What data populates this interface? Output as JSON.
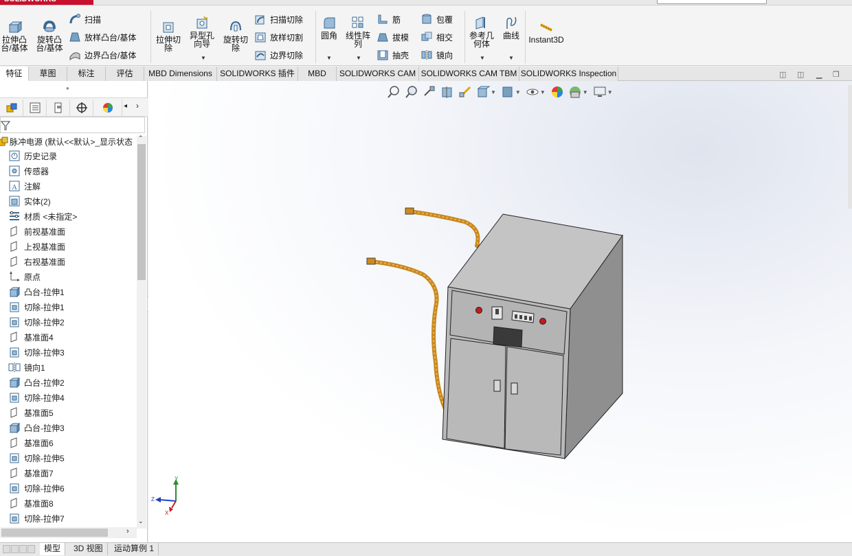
{
  "app": {
    "logo_text": "SOLIDWORKS",
    "brand_color": "#c8102e"
  },
  "ribbon": {
    "extrude_boss": "拉伸凸台/基体",
    "revolve_boss": "旋转凸台/基体",
    "sweep": "扫描",
    "loft_boss": "放样凸台/基体",
    "boundary_boss": "边界凸台/基体",
    "extrude_cut": "拉伸切除",
    "hole_wizard": "异型孔向导",
    "revolve_cut": "旋转切除",
    "sweep_cut": "扫描切除",
    "loft_cut": "放样切割",
    "boundary_cut": "边界切除",
    "fillet": "圆角",
    "linear_pattern": "线性阵列",
    "rib": "筋",
    "draft": "拔模",
    "shell": "抽壳",
    "wrap": "包覆",
    "intersect": "相交",
    "mirror": "镜向",
    "ref_geometry": "参考几何体",
    "curves": "曲线",
    "instant3d": "Instant3D"
  },
  "tabs": [
    "特征",
    "草图",
    "标注",
    "评估",
    "MBD Dimensions",
    "SOLIDWORKS 插件",
    "MBD",
    "SOLIDWORKS CAM",
    "SOLIDWORKS CAM TBM",
    "SOLIDWORKS Inspection"
  ],
  "tree": {
    "root": "脉冲电源  (默认<<默认>_显示状态",
    "items": [
      {
        "label": "历史记录",
        "icon": "history-icon"
      },
      {
        "label": "传感器",
        "icon": "sensor-icon"
      },
      {
        "label": "注解",
        "icon": "annotation-icon"
      },
      {
        "label": "实体(2)",
        "icon": "solid-bodies-icon"
      },
      {
        "label": "材质 <未指定>",
        "icon": "material-icon"
      },
      {
        "label": "前视基准面",
        "icon": "plane-icon"
      },
      {
        "label": "上视基准面",
        "icon": "plane-icon"
      },
      {
        "label": "右视基准面",
        "icon": "plane-icon"
      },
      {
        "label": "原点",
        "icon": "origin-icon"
      },
      {
        "label": "凸台-拉伸1",
        "icon": "boss-extrude-icon"
      },
      {
        "label": "切除-拉伸1",
        "icon": "cut-extrude-icon"
      },
      {
        "label": "切除-拉伸2",
        "icon": "cut-extrude-icon"
      },
      {
        "label": "基准面4",
        "icon": "plane-icon"
      },
      {
        "label": "切除-拉伸3",
        "icon": "cut-extrude-icon"
      },
      {
        "label": "镜向1",
        "icon": "mirror-icon"
      },
      {
        "label": "凸台-拉伸2",
        "icon": "boss-extrude-icon"
      },
      {
        "label": "切除-拉伸4",
        "icon": "cut-extrude-icon"
      },
      {
        "label": "基准面5",
        "icon": "plane-icon"
      },
      {
        "label": "凸台-拉伸3",
        "icon": "boss-extrude-icon"
      },
      {
        "label": "基准面6",
        "icon": "plane-icon"
      },
      {
        "label": "切除-拉伸5",
        "icon": "cut-extrude-icon"
      },
      {
        "label": "基准面7",
        "icon": "plane-icon"
      },
      {
        "label": "切除-拉伸6",
        "icon": "cut-extrude-icon"
      },
      {
        "label": "基准面8",
        "icon": "plane-icon"
      },
      {
        "label": "切除-拉伸7",
        "icon": "cut-extrude-icon"
      }
    ]
  },
  "bottom_tabs": [
    "模型",
    "3D 视图",
    "运动算例 1"
  ],
  "triad": {
    "x": "X",
    "y": "Y",
    "z": "Z"
  }
}
